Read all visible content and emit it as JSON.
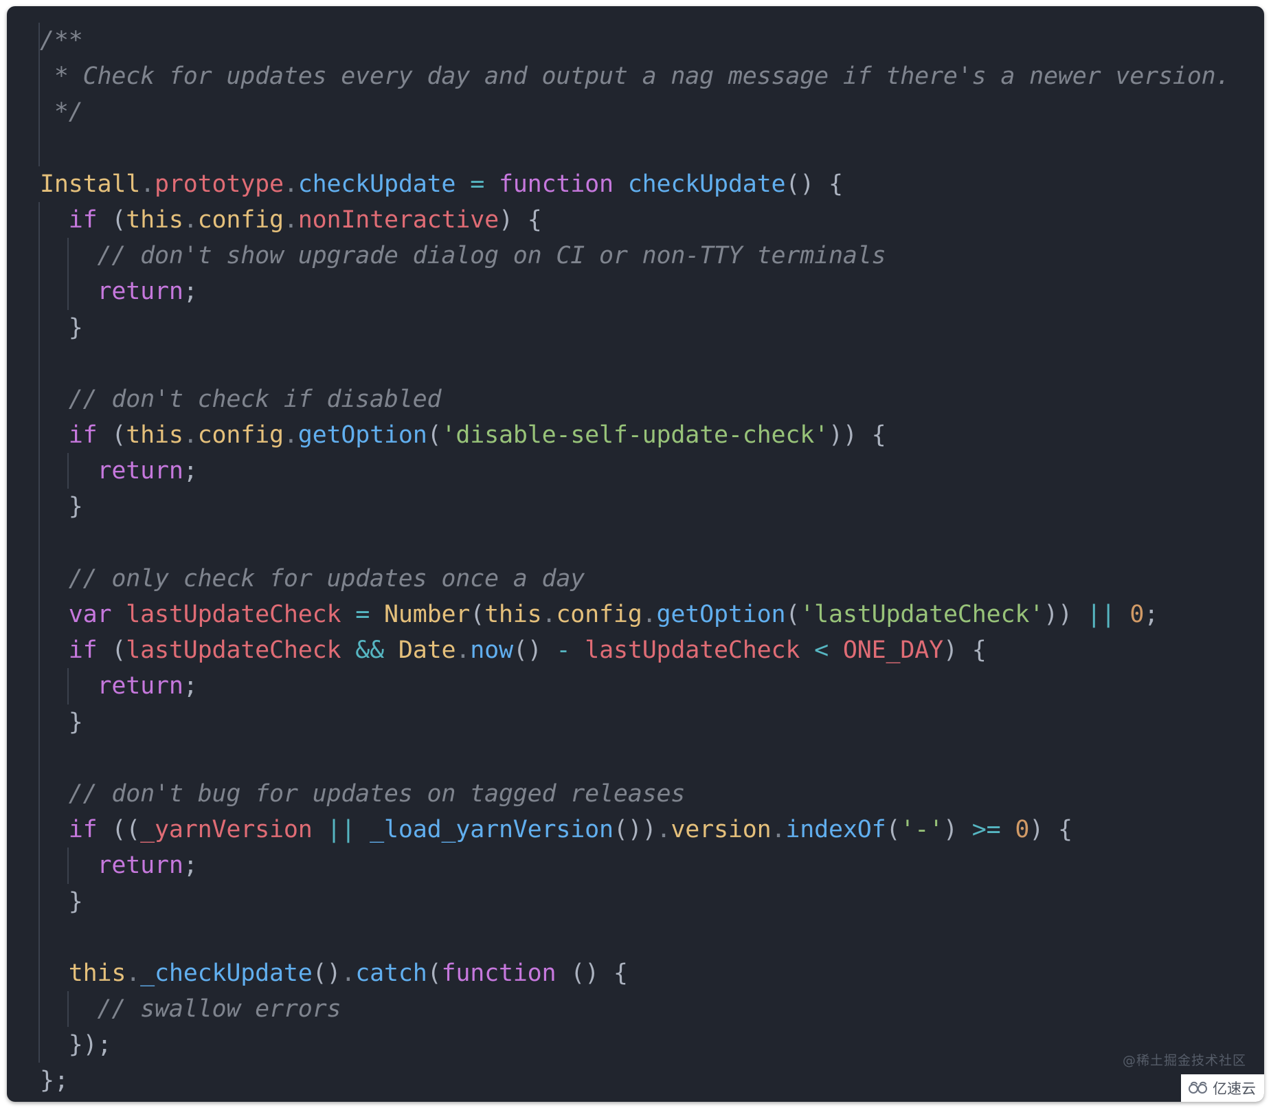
{
  "editor": {
    "theme_background": "#21252e",
    "page_background": "#ffffff",
    "default_text_color": "#abb2bf",
    "language": "javascript",
    "colors": {
      "comment": "#7f848e",
      "keyword": "#c678dd",
      "class": "#e5c07b",
      "property": "#e06c75",
      "function": "#61afef",
      "string": "#98c379",
      "operator": "#56b6c2",
      "number": "#d19a66",
      "punctuation": "#abb2bf",
      "indent_guide": "#3b414d"
    }
  },
  "code": {
    "lines": [
      "/**",
      " * Check for updates every day and output a nag message if there's a newer version.",
      " */",
      "",
      "Install.prototype.checkUpdate = function checkUpdate() {",
      "  if (this.config.nonInteractive) {",
      "    // don't show upgrade dialog on CI or non-TTY terminals",
      "    return;",
      "  }",
      "",
      "  // don't check if disabled",
      "  if (this.config.getOption('disable-self-update-check')) {",
      "    return;",
      "  }",
      "",
      "  // only check for updates once a day",
      "  var lastUpdateCheck = Number(this.config.getOption('lastUpdateCheck')) || 0;",
      "  if (lastUpdateCheck && Date.now() - lastUpdateCheck < ONE_DAY) {",
      "    return;",
      "  }",
      "",
      "  // don't bug for updates on tagged releases",
      "  if ((_yarnVersion || _load_yarnVersion()).version.indexOf('-') >= 0) {",
      "    return;",
      "  }",
      "",
      "  this._checkUpdate().catch(function () {",
      "    // swallow errors",
      "  });",
      "};"
    ],
    "tokens": {
      "comment_doc_open": "/**",
      "comment_doc_body": " * Check for updates every day and output a nag message if there's a newer version.",
      "comment_doc_close": " */",
      "install": "Install",
      "prototype": "prototype",
      "check_update": "checkUpdate",
      "equals": "=",
      "function_kw": "function",
      "if_kw": "if",
      "this_kw": "this",
      "config": "config",
      "non_interactive": "nonInteractive",
      "comment_ci": "// don't show upgrade dialog on CI or non-TTY terminals",
      "return_kw": "return",
      "comment_disabled": "// don't check if disabled",
      "get_option": "getOption",
      "str_disable_self_update_check": "'disable-self-update-check'",
      "comment_once_a_day": "// only check for updates once a day",
      "var_kw": "var",
      "last_update_check": "lastUpdateCheck",
      "number_ctor": "Number",
      "str_last_update_check": "'lastUpdateCheck'",
      "or_op": "||",
      "zero": "0",
      "and_op": "&&",
      "date_cls": "Date",
      "now_fn": "now",
      "minus_op": "-",
      "lt_op": "<",
      "one_day": "ONE_DAY",
      "comment_tagged_releases": "// don't bug for updates on tagged releases",
      "yarn_version": "_yarnVersion",
      "load_yarn_version": "_load_yarnVersion",
      "version_prop": "version",
      "index_of": "indexOf",
      "str_dash": "'-'",
      "gte_op": ">=",
      "check_update_private": "_checkUpdate",
      "catch_fn": "catch",
      "comment_swallow": "// swallow errors"
    }
  },
  "watermarks": {
    "community": "@稀土掘金技术社区",
    "badge_label": "亿速云",
    "badge_icon": "cloud-icon"
  }
}
